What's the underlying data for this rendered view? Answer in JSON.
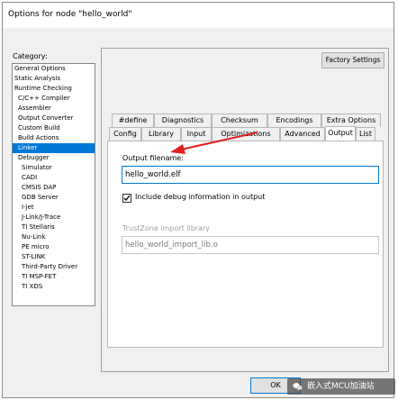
{
  "window": {
    "title": "Options for node \"hello_world\""
  },
  "category": {
    "label": "Category:",
    "items": [
      {
        "label": "General Options",
        "level": 0,
        "selected": false
      },
      {
        "label": "Static Analysis",
        "level": 0,
        "selected": false
      },
      {
        "label": "Runtime Checking",
        "level": 0,
        "selected": false
      },
      {
        "label": "C/C++ Compiler",
        "level": 1,
        "selected": false
      },
      {
        "label": "Assembler",
        "level": 1,
        "selected": false
      },
      {
        "label": "Output Converter",
        "level": 1,
        "selected": false
      },
      {
        "label": "Custom Build",
        "level": 1,
        "selected": false
      },
      {
        "label": "Build Actions",
        "level": 1,
        "selected": false
      },
      {
        "label": "Linker",
        "level": 1,
        "selected": true
      },
      {
        "label": "Debugger",
        "level": 1,
        "selected": false
      },
      {
        "label": "Simulator",
        "level": 2,
        "selected": false
      },
      {
        "label": "CADI",
        "level": 2,
        "selected": false
      },
      {
        "label": "CMSIS DAP",
        "level": 2,
        "selected": false
      },
      {
        "label": "GDB Server",
        "level": 2,
        "selected": false
      },
      {
        "label": "I-jet",
        "level": 2,
        "selected": false
      },
      {
        "label": "J-Link/J-Trace",
        "level": 2,
        "selected": false
      },
      {
        "label": "TI Stellaris",
        "level": 2,
        "selected": false
      },
      {
        "label": "Nu-Link",
        "level": 2,
        "selected": false
      },
      {
        "label": "PE micro",
        "level": 2,
        "selected": false
      },
      {
        "label": "ST-LINK",
        "level": 2,
        "selected": false
      },
      {
        "label": "Third-Party Driver",
        "level": 2,
        "selected": false
      },
      {
        "label": "TI MSP-FET",
        "level": 2,
        "selected": false
      },
      {
        "label": "TI XDS",
        "level": 2,
        "selected": false
      }
    ]
  },
  "panel": {
    "factory_settings": "Factory Settings",
    "tabs_row1": [
      "#define",
      "Diagnostics",
      "Checksum",
      "Encodings",
      "Extra Options"
    ],
    "tabs_row2": [
      "Config",
      "Library",
      "Input",
      "Optimizations",
      "Advanced",
      "Output",
      "List"
    ],
    "active_tab": "Output"
  },
  "output": {
    "filename_label": "Output filename:",
    "filename_value": "hello_world.elf",
    "include_debug_label": "Include debug information in output",
    "include_debug_checked": true,
    "trustzone_label": "TrustZone import library",
    "trustzone_value": "hello_world_import_lib.o"
  },
  "footer": {
    "ok_label": "OK",
    "watermark_text": "嵌入式MCU加油站"
  },
  "colors": {
    "selection": "#0078d7",
    "annotation_arrow": "#e02020"
  }
}
